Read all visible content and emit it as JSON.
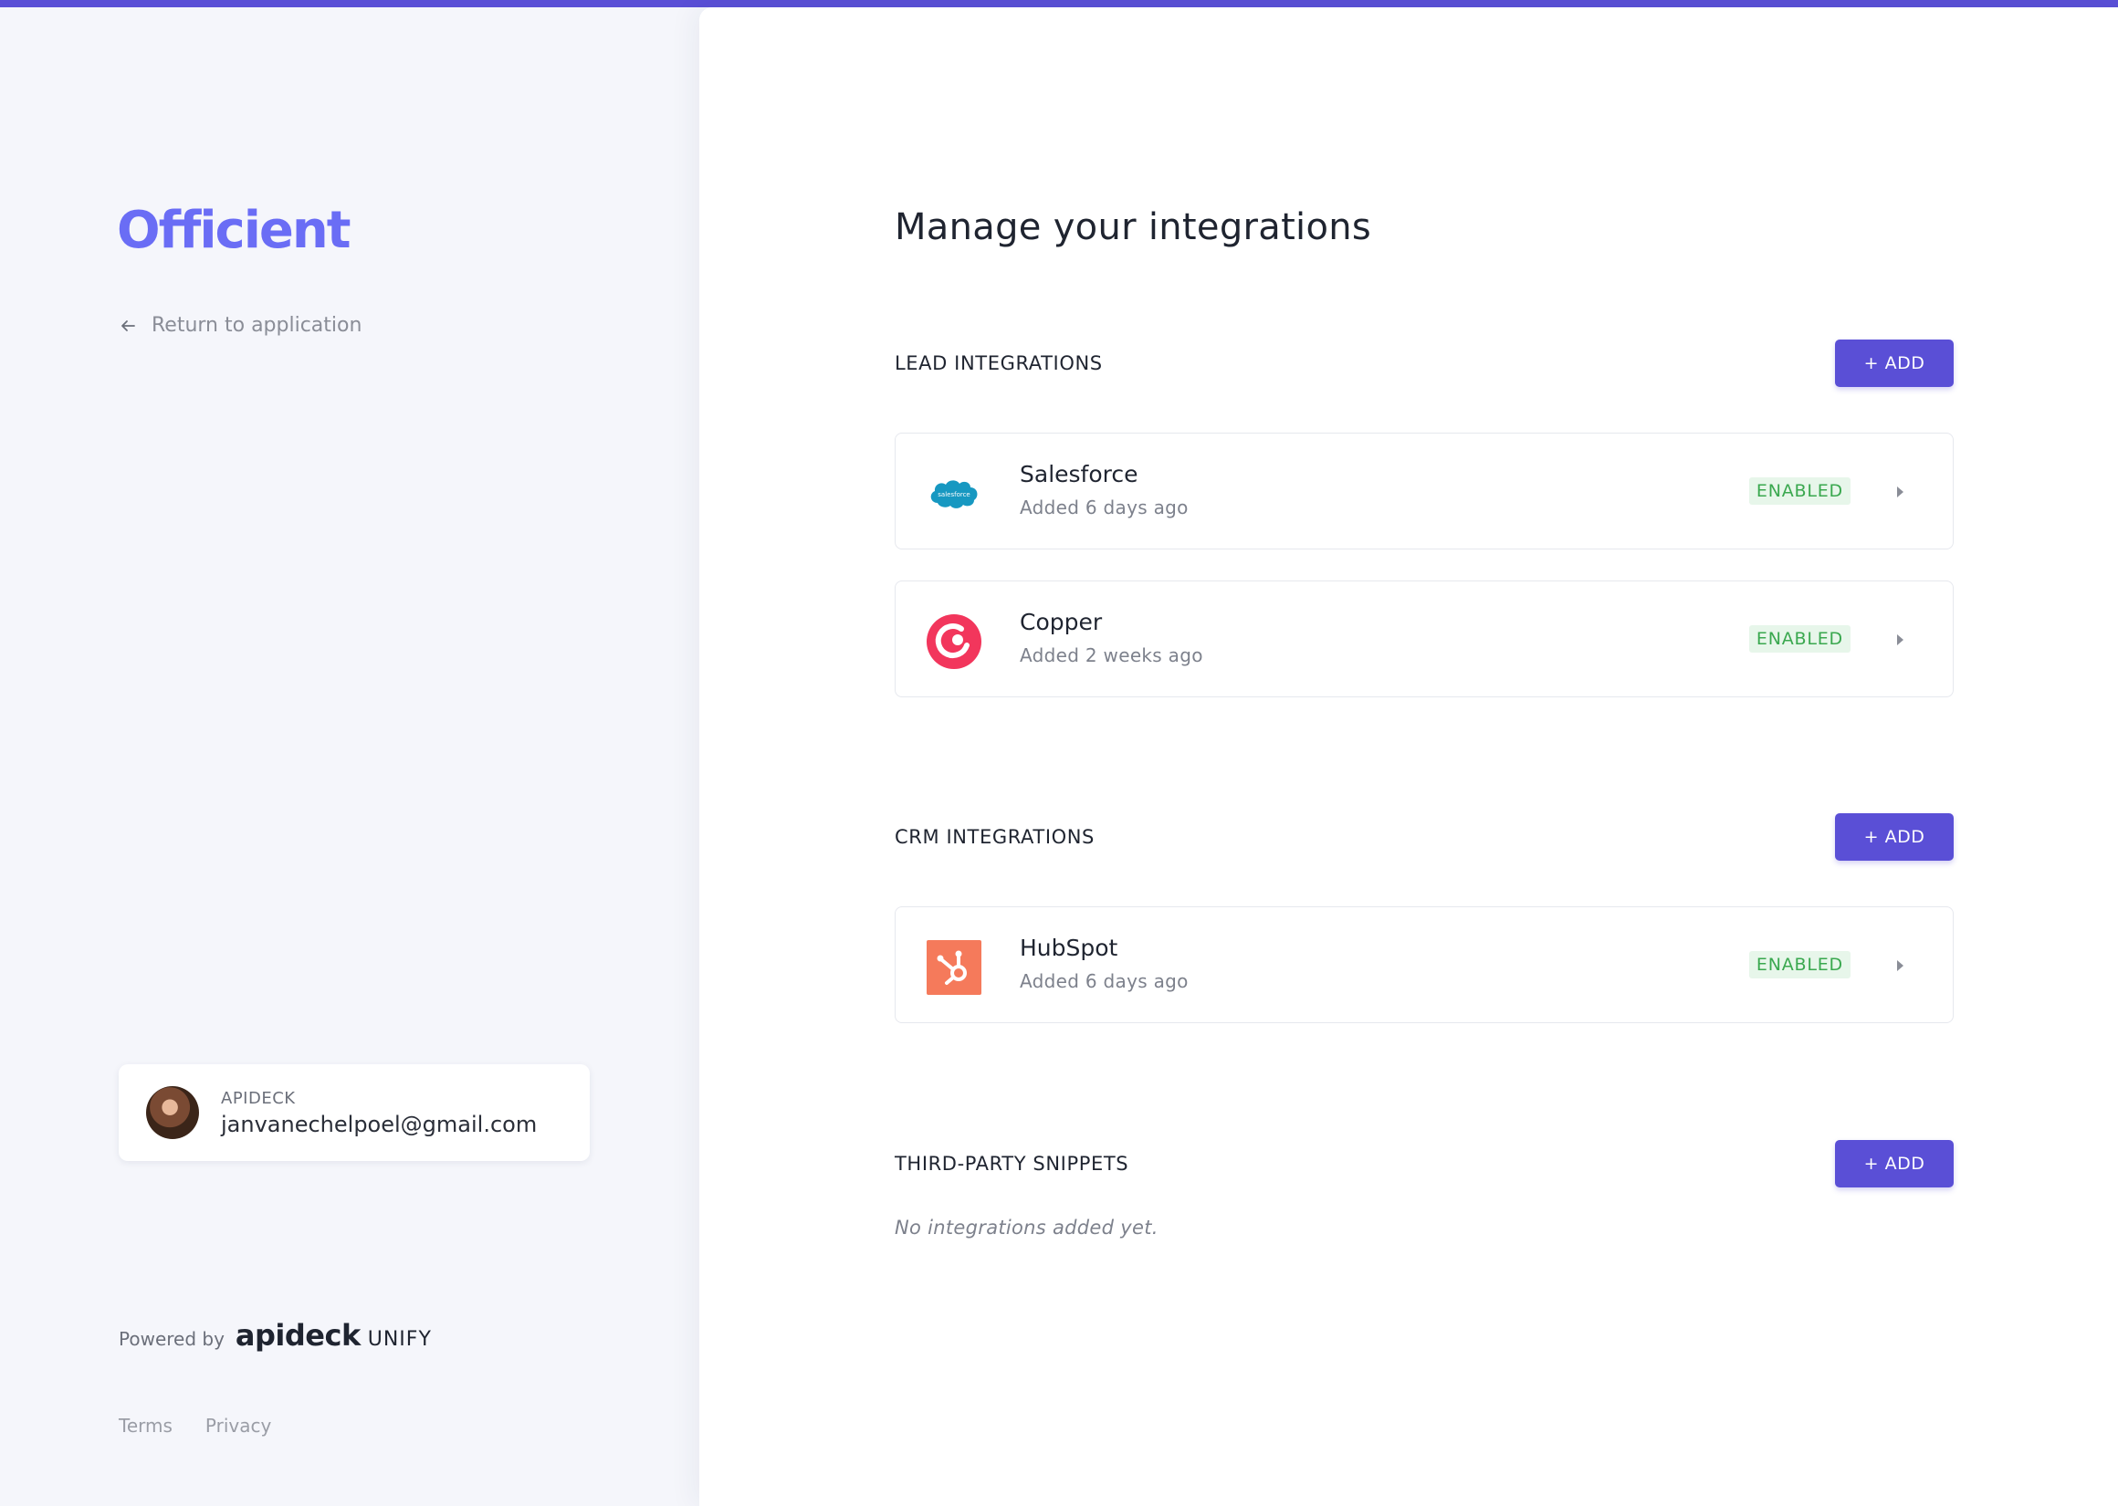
{
  "sidebar": {
    "logo": "Officient",
    "return_link": "Return to application",
    "account": {
      "org": "APIDECK",
      "email": "janvanechelpoel@gmail.com"
    },
    "powered": {
      "label": "Powered by",
      "brand": "apideck",
      "product": "UNIFY"
    },
    "footer": {
      "terms": "Terms",
      "privacy": "Privacy"
    }
  },
  "main": {
    "title": "Manage your integrations",
    "sections": [
      {
        "title": "LEAD INTEGRATIONS",
        "add_label": "+ ADD",
        "items": [
          {
            "name": "Salesforce",
            "meta": "Added 6 days ago",
            "status": "ENABLED",
            "icon": "salesforce-icon",
            "logo_text": "salesforce"
          },
          {
            "name": "Copper",
            "meta": "Added 2 weeks ago",
            "status": "ENABLED",
            "icon": "copper-icon"
          }
        ]
      },
      {
        "title": "CRM INTEGRATIONS",
        "add_label": "+ ADD",
        "items": [
          {
            "name": "HubSpot",
            "meta": "Added 6 days ago",
            "status": "ENABLED",
            "icon": "hubspot-icon"
          }
        ]
      },
      {
        "title": "THIRD-PARTY SNIPPETS",
        "add_label": "+ ADD",
        "empty": "No integrations added yet."
      }
    ]
  },
  "colors": {
    "accent": "#5a4fd6",
    "logo": "#6a6df5",
    "enabled": "#3aa84f",
    "salesforce": "#1798c1",
    "copper": "#f2365c",
    "hubspot": "#f57a5b"
  }
}
